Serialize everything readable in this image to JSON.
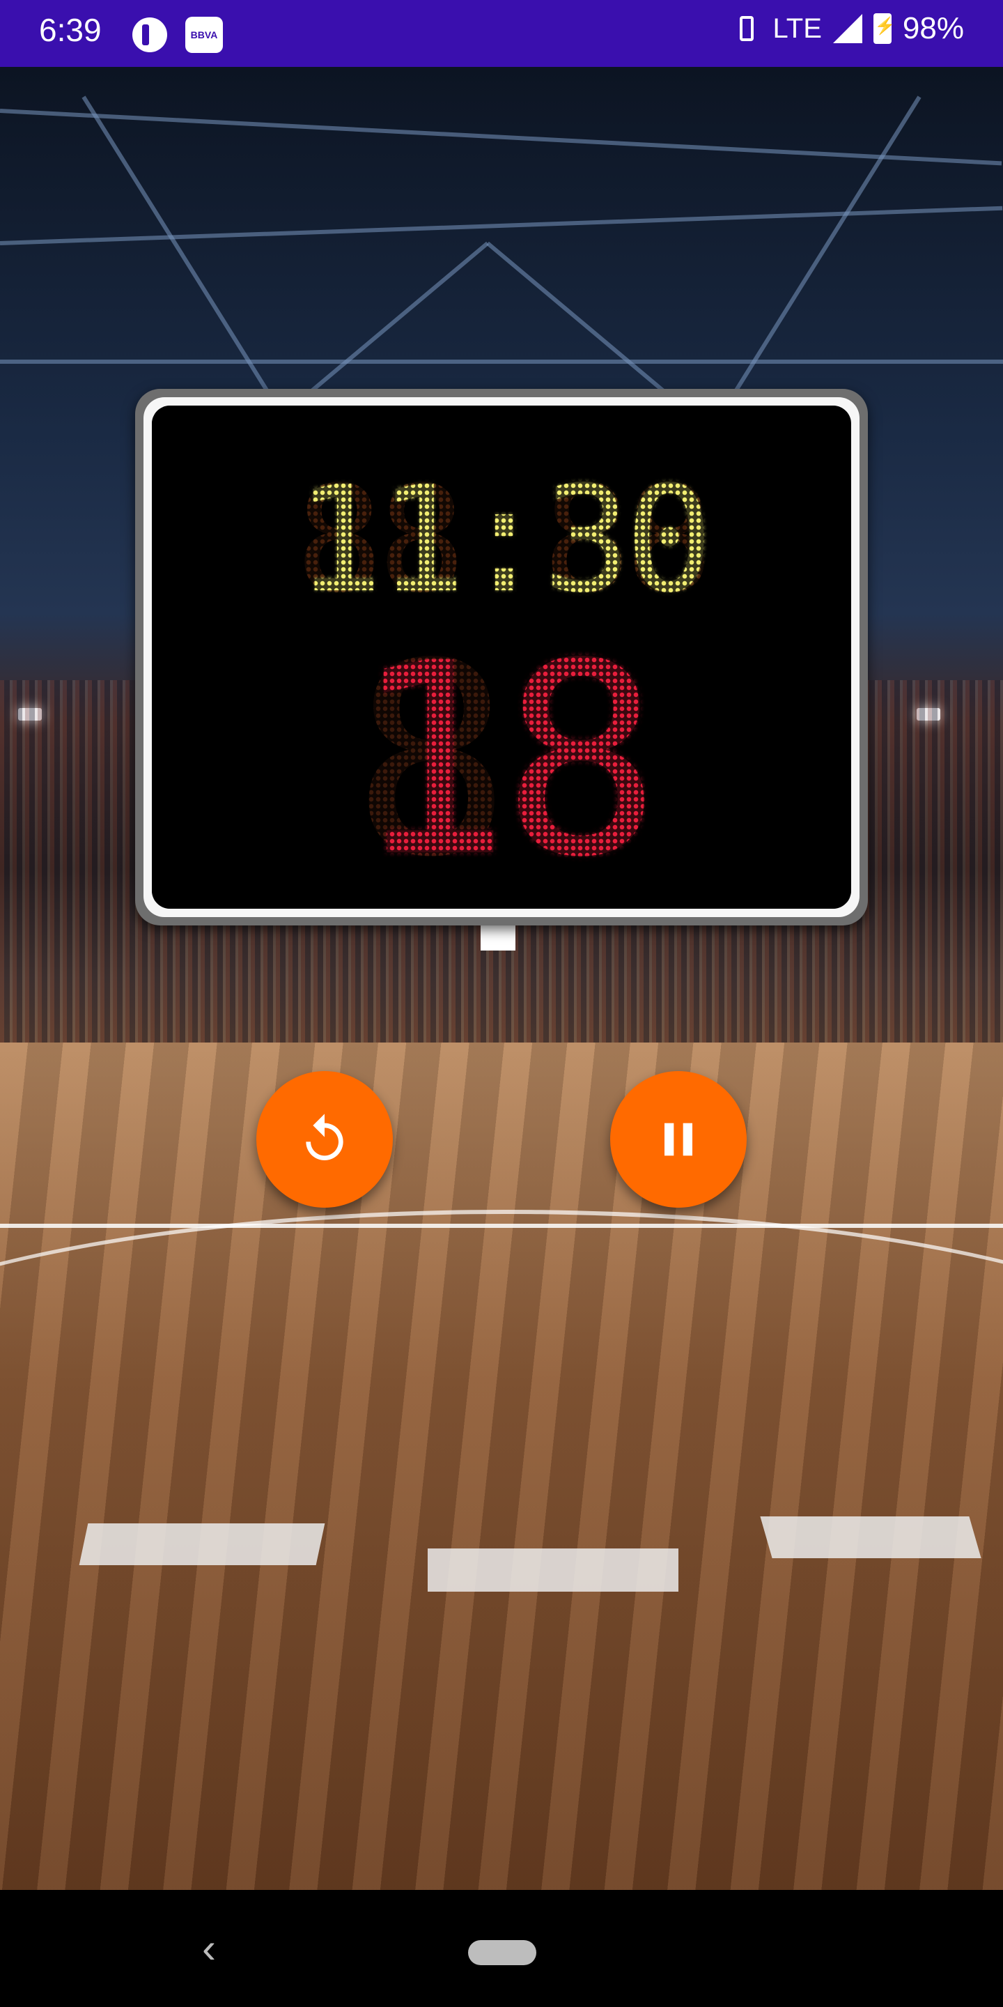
{
  "status_bar": {
    "time": "6:39",
    "app_icon_2_label": "BBVA",
    "network": "LTE",
    "battery": "98%"
  },
  "scoreboard": {
    "game_clock": "11:30",
    "game_clock_ghost": "88:88",
    "shot_clock": "18",
    "shot_clock_ghost": "88",
    "clock_color": "#f2ee72",
    "shot_color": "#e81e3c"
  },
  "controls": {
    "reset_icon": "reset-icon",
    "pause_icon": "pause-icon",
    "accent": "#ff6a00"
  },
  "navigation": {
    "back_glyph": "‹"
  }
}
